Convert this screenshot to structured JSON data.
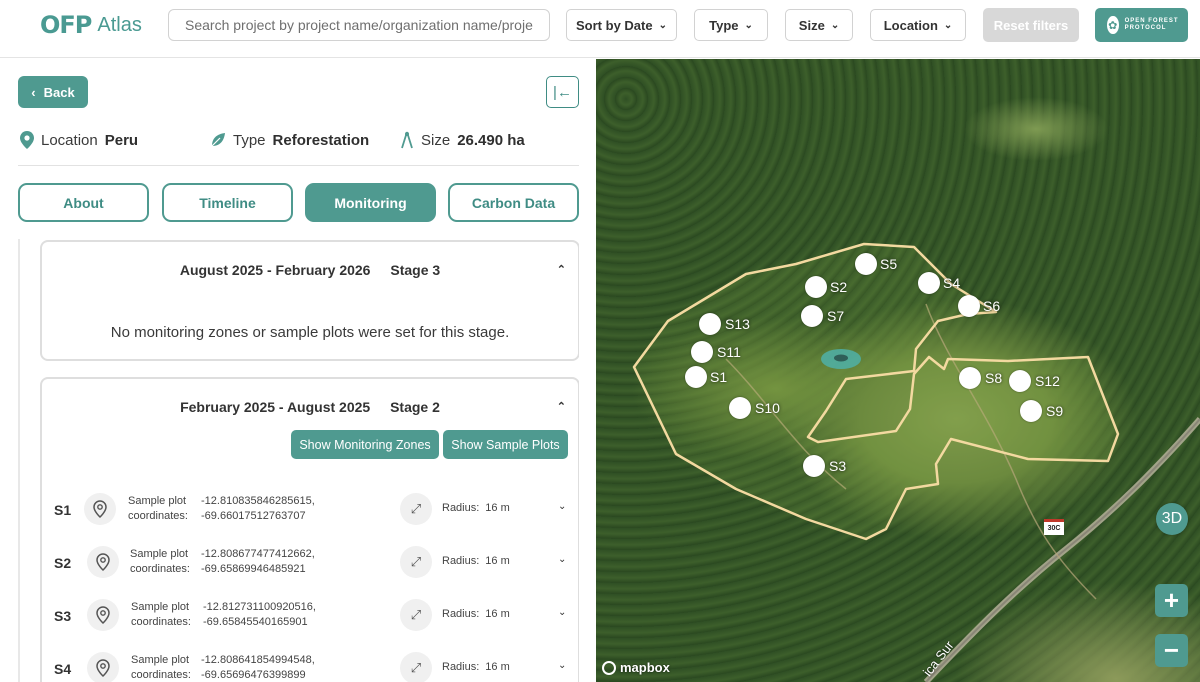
{
  "header": {
    "logo_mark": "OFP",
    "logo_text": "Atlas",
    "search_placeholder": "Search project by project name/organization name/project",
    "filters": {
      "sort_label": "Sort by Date",
      "type_label": "Type",
      "size_label": "Size",
      "location_label": "Location",
      "reset_label": "Reset filters"
    },
    "ofp_brand_text": "Open Forest Protocol"
  },
  "panel": {
    "back_label": "Back",
    "collapse_icon": "collapse-left-icon",
    "meta": {
      "location_label": "Location",
      "location_value": "Peru",
      "type_label": "Type",
      "type_value": "Reforestation",
      "size_label": "Size",
      "size_value": "26.490 ha"
    },
    "tabs": [
      {
        "label": "About",
        "active": false
      },
      {
        "label": "Timeline",
        "active": false
      },
      {
        "label": "Monitoring",
        "active": true
      },
      {
        "label": "Carbon Data",
        "active": false
      }
    ],
    "stages": [
      {
        "period": "August 2025 - February 2026",
        "stage": "Stage 3",
        "message": "No monitoring zones or sample plots were set for this stage."
      },
      {
        "period": "February 2025 - August 2025",
        "stage": "Stage 2",
        "show_zones_label": "Show Monitoring Zones",
        "show_plots_label": "Show Sample Plots",
        "plots": [
          {
            "name": "S1",
            "label_line1": "Sample plot",
            "label_line2": "coordinates:",
            "lat": "-12.810835846285615,",
            "lon": "-69.66017512763707",
            "radius_label": "Radius:",
            "radius_value": "16 m"
          },
          {
            "name": "S2",
            "label_line1": "Sample plot",
            "label_line2": "coordinates:",
            "lat": "-12.808677477412662,",
            "lon": "-69.65869946485921",
            "radius_label": "Radius:",
            "radius_value": "16 m"
          },
          {
            "name": "S3",
            "label_line1": "Sample plot",
            "label_line2": "coordinates:",
            "lat": "-12.812731100920516,",
            "lon": "-69.65845540165901",
            "radius_label": "Radius:",
            "radius_value": "16 m"
          },
          {
            "name": "S4",
            "label_line1": "Sample plot",
            "label_line2": "coordinates:",
            "lat": "-12.808641854994548,",
            "lon": "-69.65696476399899",
            "radius_label": "Radius:",
            "radius_value": "16 m"
          }
        ]
      }
    ]
  },
  "map": {
    "markers": [
      "S1",
      "S2",
      "S3",
      "S4",
      "S5",
      "S6",
      "S7",
      "S8",
      "S9",
      "S10",
      "S11",
      "S12",
      "S13"
    ],
    "btn_3d_label": "3D",
    "zoom_in_label": "+",
    "zoom_out_label": "−",
    "attribution": "mapbox",
    "road_label": "ica Sur",
    "road_shield": "30C",
    "accent_color": "#4f9a90",
    "boundary_color": "#f3d9a0"
  }
}
